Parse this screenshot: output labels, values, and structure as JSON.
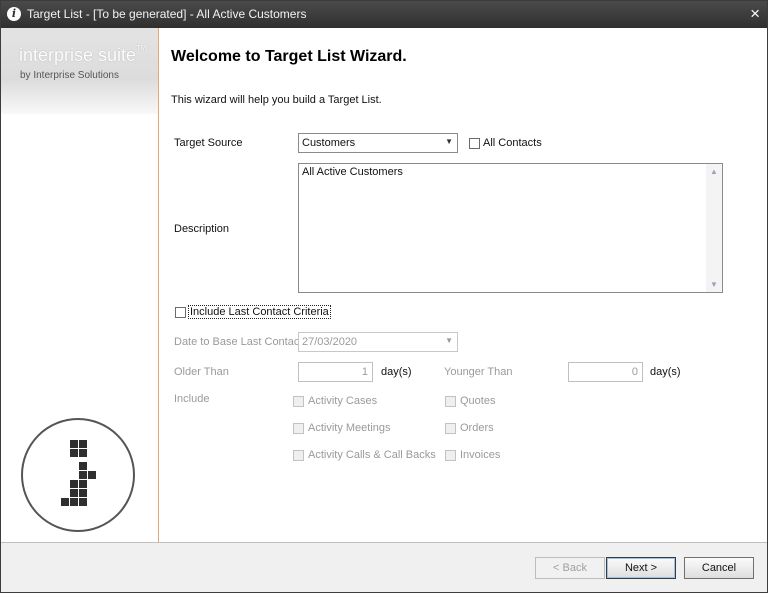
{
  "window": {
    "title": "Target List - [To be generated] - All Active Customers",
    "info_icon": "i",
    "close_glyph": "×"
  },
  "sidebar": {
    "logo_main": "interprise suite",
    "logo_tm": "TM",
    "logo_sub": "by Interprise Solutions"
  },
  "wizard": {
    "title": "Welcome to Target List Wizard.",
    "subtitle": "This wizard will help you build a Target List."
  },
  "form": {
    "target_source_label": "Target Source",
    "target_source_value": "Customers",
    "all_contacts_label": "All Contacts",
    "all_contacts_checked": false,
    "description_label": "Description",
    "description_value": "All Active Customers",
    "include_last_contact_label": "Include Last Contact Criteria",
    "include_last_contact_checked": false,
    "date_label": "Date to Base Last Contact",
    "date_value": "27/03/2020",
    "older_than_label": "Older Than",
    "older_than_value": "1",
    "older_unit": "day(s)",
    "younger_than_label": "Younger Than",
    "younger_than_value": "0",
    "younger_unit": "day(s)",
    "include_label": "Include",
    "include_options": {
      "activity_cases": "Activity Cases",
      "activity_meetings": "Activity Meetings",
      "activity_calls": "Activity Calls & Call Backs",
      "quotes": "Quotes",
      "orders": "Orders",
      "invoices": "Invoices"
    }
  },
  "buttons": {
    "back": "< Back",
    "next": "Next >",
    "cancel": "Cancel"
  },
  "icons": {
    "dropdown": "dropdown-arrow-icon",
    "scroll_up": "scroll-up-arrow-icon",
    "scroll_down": "scroll-down-arrow-icon",
    "info": "info-icon",
    "close": "close-icon"
  },
  "colors": {
    "titlebar": "#303030",
    "sidebar_border": "#e8a770"
  }
}
